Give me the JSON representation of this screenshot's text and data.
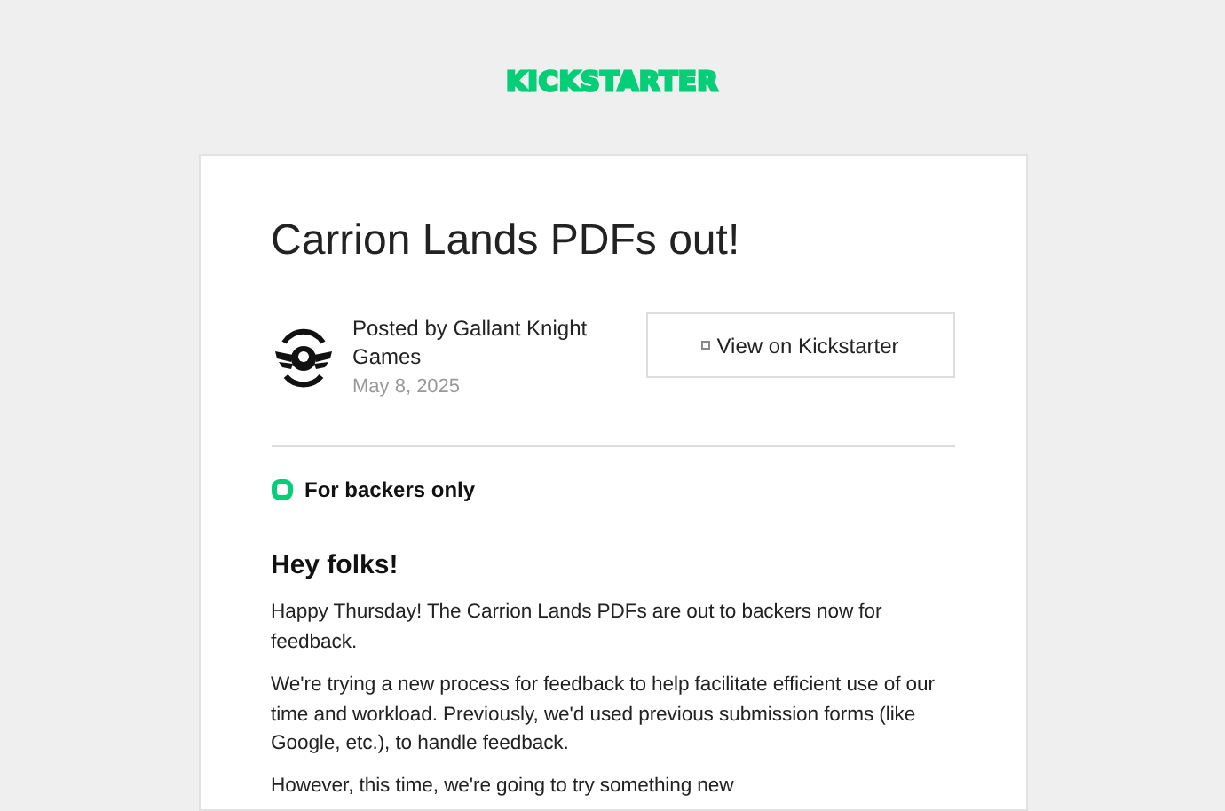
{
  "logo": {
    "text": "KICKSTARTER"
  },
  "post": {
    "title": "Carrion Lands PDFs out!",
    "author": "Posted by Gallant Knight Games",
    "date": "May 8, 2025",
    "button": "View on Kickstarter",
    "audience": "For backers only",
    "heading": "Hey folks!",
    "paragraphs": [
      "Happy Thursday! The Carrion Lands PDFs are out to backers now for feedback.",
      "We're trying a new process for feedback to help facilitate efficient use of our time and workload. Previously, we'd used previous submission forms (like Google, etc.), to handle feedback.",
      "However, this time, we're going to try something new"
    ]
  }
}
